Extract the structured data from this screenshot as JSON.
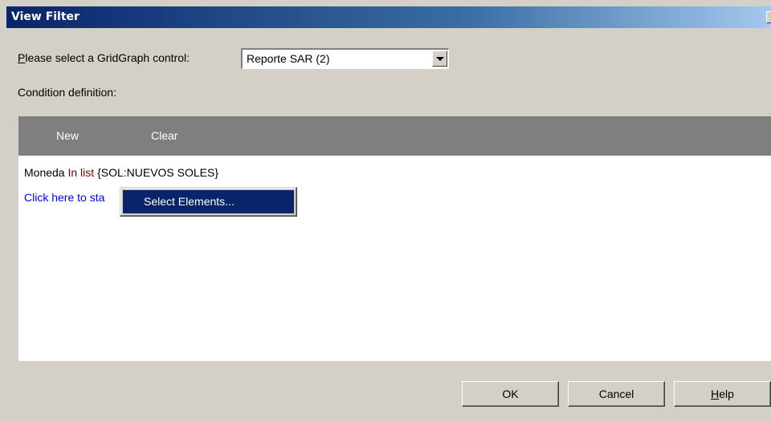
{
  "window": {
    "title": "View Filter",
    "close_glyph": "×"
  },
  "control_select": {
    "label_accel": "P",
    "label_rest": "lease select a GridGraph control:",
    "value": "Reporte SAR (2)"
  },
  "condition_label": "Condition definition:",
  "toolbar": {
    "new_label": "New",
    "clear_label": "Clear"
  },
  "condition": {
    "field": "Moneda",
    "operator": "In list",
    "value": "{SOL:NUEVOS SOLES}"
  },
  "add_link": "Click here to sta",
  "context_menu": {
    "item": "Select Elements..."
  },
  "buttons": {
    "ok": "OK",
    "cancel": "Cancel",
    "help_accel": "H",
    "help_rest": "elp"
  }
}
